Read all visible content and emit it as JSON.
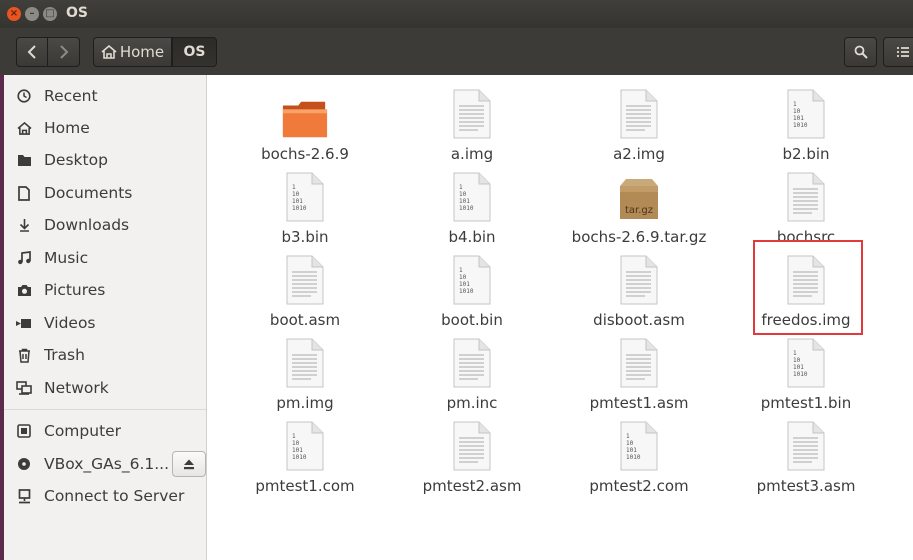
{
  "window": {
    "title": "OS"
  },
  "toolbar": {
    "back_icon": "chevron-left-icon",
    "forward_icon": "chevron-right-icon",
    "breadcrumbs": [
      {
        "label": "Home",
        "icon": "home-icon"
      },
      {
        "label": "OS"
      }
    ],
    "search_icon": "search-icon",
    "view_icon": "list-view-icon"
  },
  "sidebar": {
    "items": [
      {
        "label": "Recent",
        "icon": "clock-icon"
      },
      {
        "label": "Home",
        "icon": "home-icon"
      },
      {
        "label": "Desktop",
        "icon": "folder-icon"
      },
      {
        "label": "Documents",
        "icon": "document-icon"
      },
      {
        "label": "Downloads",
        "icon": "download-icon"
      },
      {
        "label": "Music",
        "icon": "music-icon"
      },
      {
        "label": "Pictures",
        "icon": "camera-icon"
      },
      {
        "label": "Videos",
        "icon": "video-icon"
      },
      {
        "label": "Trash",
        "icon": "trash-icon"
      },
      {
        "label": "Network",
        "icon": "network-icon"
      }
    ],
    "devices": [
      {
        "label": "Computer",
        "icon": "drive-icon"
      },
      {
        "label": "VBox_GAs_6.1...",
        "icon": "disc-icon",
        "eject_icon": "eject-icon"
      },
      {
        "label": "Connect to Server",
        "icon": "server-icon"
      }
    ]
  },
  "files": [
    {
      "name": "bochs-2.6.9",
      "type": "folder"
    },
    {
      "name": "a.img",
      "type": "text"
    },
    {
      "name": "a2.img",
      "type": "text"
    },
    {
      "name": "b2.bin",
      "type": "binary"
    },
    {
      "name": "b3.bin",
      "type": "binary"
    },
    {
      "name": "b4.bin",
      "type": "binary"
    },
    {
      "name": "bochs-2.6.9.tar.gz",
      "type": "archive",
      "badge": "tar.gz"
    },
    {
      "name": "bochsrc",
      "type": "text"
    },
    {
      "name": "boot.asm",
      "type": "text"
    },
    {
      "name": "boot.bin",
      "type": "binary"
    },
    {
      "name": "disboot.asm",
      "type": "text"
    },
    {
      "name": "freedos.img",
      "type": "text",
      "highlighted": true
    },
    {
      "name": "pm.img",
      "type": "text"
    },
    {
      "name": "pm.inc",
      "type": "text"
    },
    {
      "name": "pmtest1.asm",
      "type": "text"
    },
    {
      "name": "pmtest1.bin",
      "type": "binary"
    },
    {
      "name": "pmtest1.com",
      "type": "binary"
    },
    {
      "name": "pmtest2.asm",
      "type": "text"
    },
    {
      "name": "pmtest2.com",
      "type": "binary"
    },
    {
      "name": "pmtest3.asm",
      "type": "text"
    }
  ],
  "binary_icon_lines": [
    "1",
    "10",
    "101",
    "1010"
  ],
  "colors": {
    "accent": "#e95420",
    "highlight_box": "#e03a3a",
    "titlebar": "#3c3b37"
  }
}
